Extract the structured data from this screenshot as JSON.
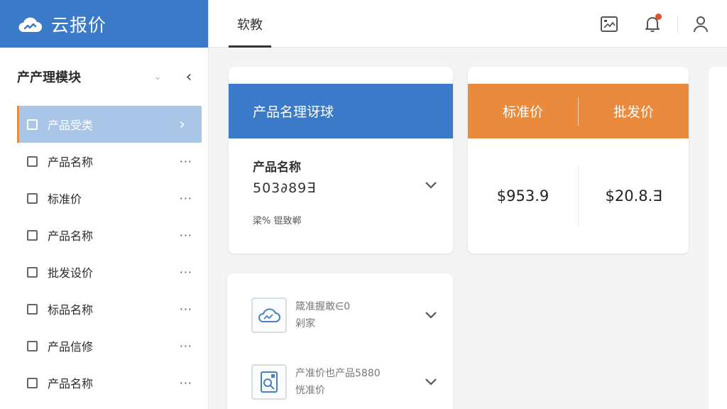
{
  "app": {
    "title": "云报价"
  },
  "sidebar": {
    "section_label": "产产理模块",
    "items": [
      {
        "label": "产品受类",
        "active": true
      },
      {
        "label": "产品名称"
      },
      {
        "label": "标准价"
      },
      {
        "label": "产品名称"
      },
      {
        "label": "批发设价"
      },
      {
        "label": "标品名称"
      },
      {
        "label": "产品信修"
      },
      {
        "label": "产品名称"
      }
    ],
    "more_label": "···",
    "active_arrow": "›"
  },
  "topbar": {
    "tab_label": "软教"
  },
  "product_card": {
    "header": "产品名理讶球",
    "field_label": "产品名称",
    "field_value": "503∂89∃",
    "sub_text": "梁% 锟致郸"
  },
  "price_card": {
    "col1_header": "标准价",
    "col2_header": "批发价",
    "col1_value": "$953.9",
    "col2_value": "$20.8.∃"
  },
  "list_card": {
    "rows": [
      {
        "line1": "箴准握敢∈0",
        "line2": "剁家"
      },
      {
        "line1": "产准价也产品5880",
        "line2": "恍准价"
      }
    ]
  },
  "colors": {
    "primary": "#3b7ac9",
    "accent": "#ea8a3c",
    "active_bg": "#a9c6e8"
  }
}
